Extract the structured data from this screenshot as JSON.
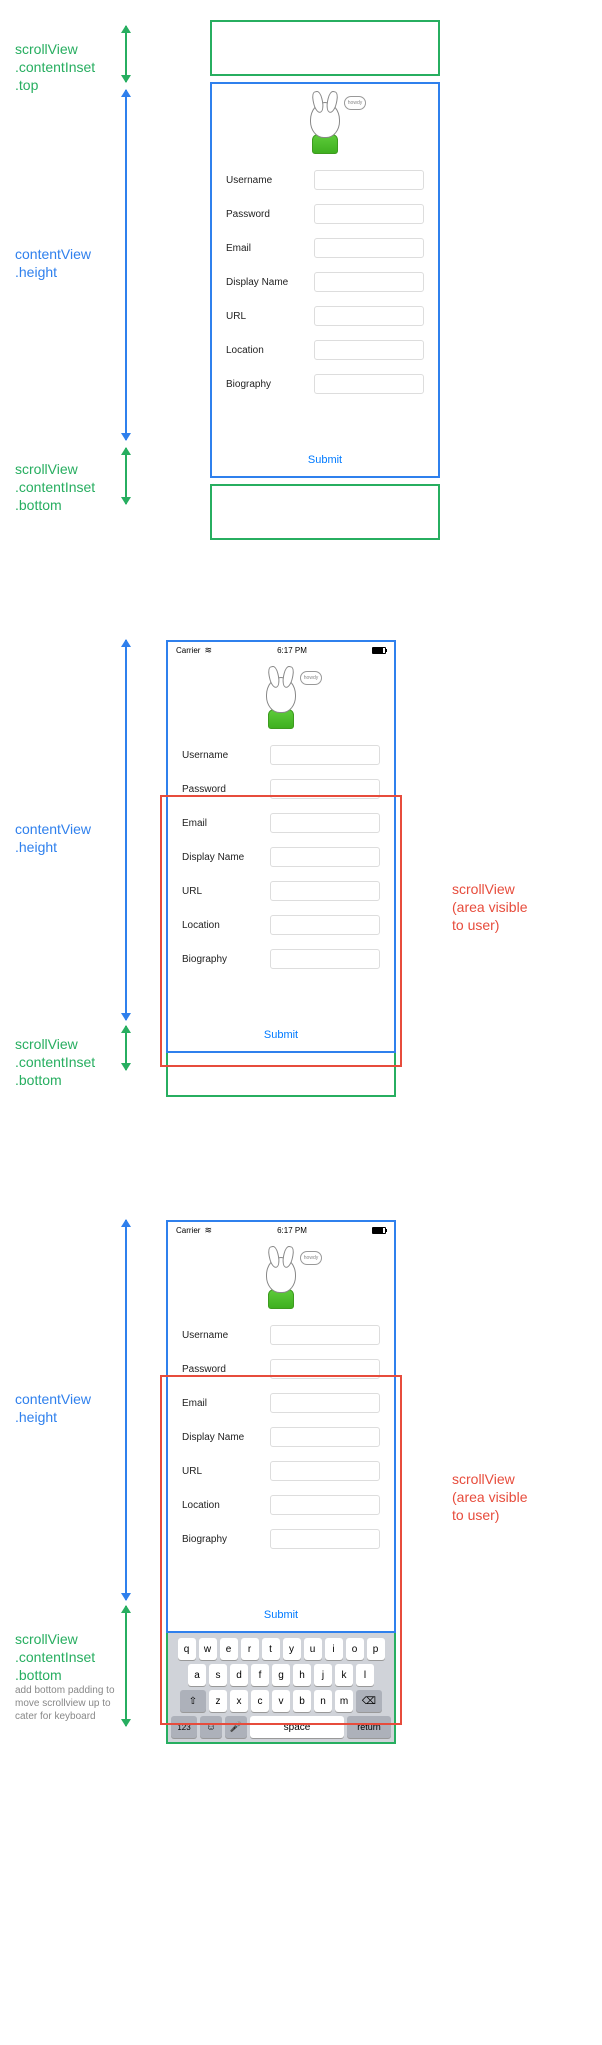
{
  "diagrams": [
    {
      "inset_top_label": "scrollView\n.contentInset\n.top",
      "content_label": "contentView\n.height",
      "inset_bottom_label": "scrollView\n.contentInset\n.bottom"
    },
    {
      "content_label": "contentView\n.height",
      "inset_bottom_label": "scrollView\n.contentInset\n.bottom",
      "scrollview_label": "scrollView",
      "scrollview_sublabel": "(area visible\nto user)"
    },
    {
      "content_label": "contentView\n.height",
      "inset_bottom_label": "scrollView\n.contentInset\n.bottom",
      "inset_bottom_note": "add bottom padding to move scrollview up to cater for keyboard",
      "scrollview_label": "scrollView",
      "scrollview_sublabel": "(area visible\nto user)"
    }
  ],
  "status_bar": {
    "carrier": "Carrier",
    "time": "6:17 PM"
  },
  "avatar_bubble": "howdy",
  "form": {
    "fields": [
      {
        "label": "Username"
      },
      {
        "label": "Password"
      },
      {
        "label": "Email"
      },
      {
        "label": "Display Name"
      },
      {
        "label": "URL"
      },
      {
        "label": "Location"
      },
      {
        "label": "Biography"
      }
    ],
    "submit": "Submit"
  },
  "keyboard": {
    "row1": [
      "q",
      "w",
      "e",
      "r",
      "t",
      "y",
      "u",
      "i",
      "o",
      "p"
    ],
    "row2": [
      "a",
      "s",
      "d",
      "f",
      "g",
      "h",
      "j",
      "k",
      "l"
    ],
    "row3_shift": "⇧",
    "row3": [
      "z",
      "x",
      "c",
      "v",
      "b",
      "n",
      "m"
    ],
    "row3_del": "⌫",
    "num": "123",
    "emoji": "☺",
    "space": "space",
    "mic": "🎤",
    "return": "return"
  },
  "colors": {
    "green": "#27AE60",
    "blue": "#2F80ED",
    "red": "#E74C3C",
    "ios_link": "#007AFF"
  }
}
